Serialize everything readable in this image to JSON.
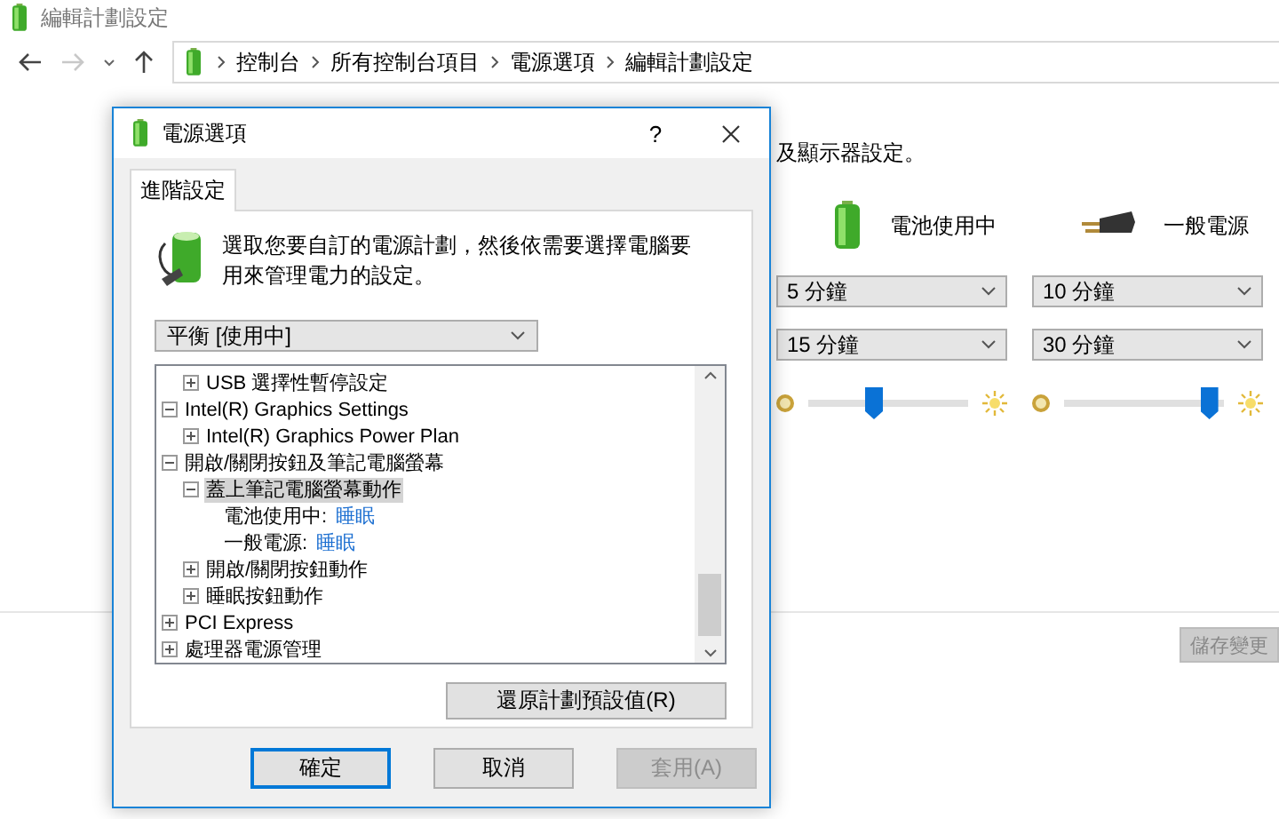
{
  "window": {
    "title": "編輯計劃設定"
  },
  "nav": {
    "breadcrumb": [
      "控制台",
      "所有控制台項目",
      "電源選項",
      "編輯計劃設定"
    ]
  },
  "page": {
    "description": "及顯示器設定。",
    "columns": [
      {
        "kind": "battery",
        "label": "電池使用中",
        "dropdowns": [
          "5 分鐘",
          "15 分鐘"
        ],
        "level": 0.4
      },
      {
        "kind": "plug",
        "label": "一般電源",
        "dropdowns": [
          "10 分鐘",
          "30 分鐘"
        ],
        "level": 0.96
      }
    ],
    "save_button": {
      "label": "儲存變更",
      "disabled": true
    }
  },
  "dialog": {
    "title": "電源選項",
    "help": "?",
    "tabs": [
      {
        "label": "進階設定",
        "selected": true
      }
    ],
    "intro": "選取您要自訂的電源計劃，然後依需要選擇電腦要用來管理電力的設定。",
    "plan": "平衡 [使用中]",
    "tree": [
      {
        "kind": "node",
        "children": [
          {
            "kind": "node",
            "label": "USB 選擇性暫停設定",
            "expanded": false,
            "selected": false
          }
        ]
      },
      {
        "kind": "node",
        "label": "Intel(R) Graphics Settings",
        "expanded": true,
        "selected": false,
        "children": [
          {
            "kind": "node",
            "label": "Intel(R) Graphics Power Plan",
            "expanded": false,
            "selected": false
          }
        ]
      },
      {
        "kind": "node",
        "label": "開啟/關閉按鈕及筆記電腦螢幕",
        "expanded": true,
        "selected": false,
        "children": [
          {
            "kind": "node",
            "label": "蓋上筆記電腦螢幕動作",
            "expanded": true,
            "selected": true,
            "children": [
              {
                "kind": "setting",
                "label": "電池使用中:",
                "value": "睡眠",
                "selected": false
              },
              {
                "kind": "setting",
                "label": "一般電源:",
                "value": "睡眠",
                "selected": false
              }
            ]
          },
          {
            "kind": "node",
            "label": "開啟/關閉按鈕動作",
            "expanded": false,
            "selected": false
          },
          {
            "kind": "node",
            "label": "睡眠按鈕動作",
            "expanded": false,
            "selected": false
          }
        ]
      },
      {
        "kind": "node",
        "label": "PCI Express",
        "expanded": false,
        "selected": false
      },
      {
        "kind": "node",
        "label": "處理器電源管理",
        "expanded": false,
        "selected": false
      }
    ],
    "restore_button": "還原計劃預設值(R)",
    "buttons": [
      {
        "label": "確定",
        "default": true,
        "disabled": false
      },
      {
        "label": "取消",
        "default": false,
        "disabled": false
      },
      {
        "label": "套用(A)",
        "default": false,
        "disabled": true
      }
    ]
  }
}
